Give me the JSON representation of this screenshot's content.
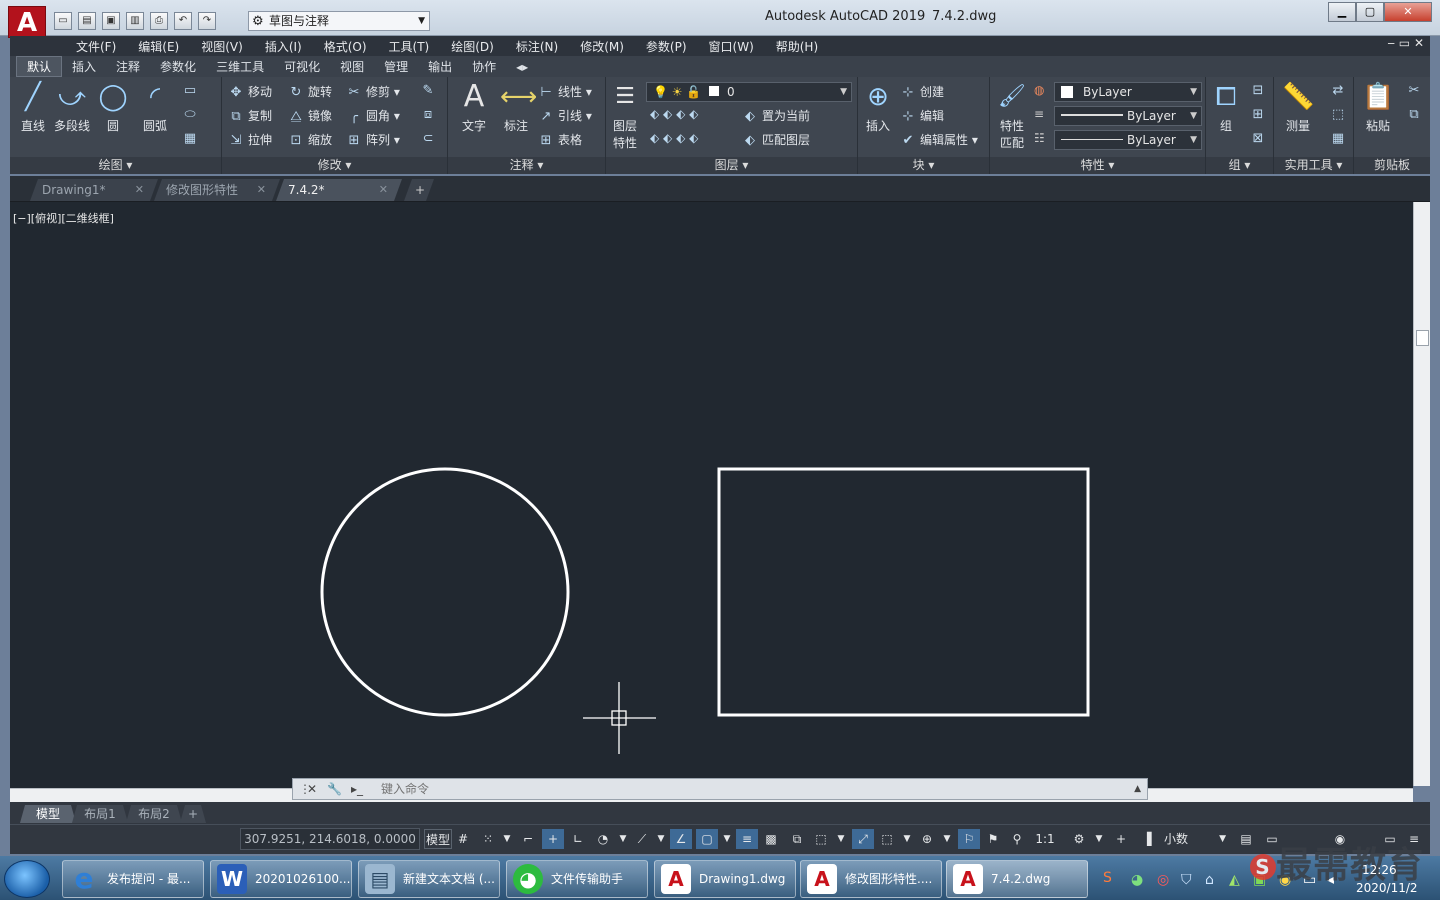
{
  "window": {
    "app_title": "Autodesk AutoCAD 2019",
    "file_title": "7.4.2.dwg",
    "workspace": "草图与注释",
    "logo_letter": "A"
  },
  "menu": [
    "文件(F)",
    "编辑(E)",
    "视图(V)",
    "插入(I)",
    "格式(O)",
    "工具(T)",
    "绘图(D)",
    "标注(N)",
    "修改(M)",
    "参数(P)",
    "窗口(W)",
    "帮助(H)"
  ],
  "ribbon_tabs": [
    "默认",
    "插入",
    "注释",
    "参数化",
    "三维工具",
    "可视化",
    "视图",
    "管理",
    "输出",
    "协作"
  ],
  "panels": {
    "draw": {
      "title": "绘图",
      "line": "直线",
      "polyline": "多段线",
      "circle": "圆",
      "arc": "圆弧"
    },
    "modify": {
      "title": "修改",
      "move": "移动",
      "rotate": "旋转",
      "trim": "修剪",
      "copy": "复制",
      "mirror": "镜像",
      "fillet": "圆角",
      "stretch": "拉伸",
      "scale": "缩放",
      "array": "阵列"
    },
    "annotation": {
      "title": "注释",
      "text": "文字",
      "dimension": "标注",
      "linear": "线性",
      "leader": "引线",
      "table": "表格"
    },
    "layers": {
      "title": "图层",
      "properties_1": "图层",
      "properties_2": "特性",
      "current_layer": "0",
      "set_current": "置为当前",
      "match_layer": "匹配图层"
    },
    "block": {
      "title": "块",
      "insert": "插入",
      "create": "创建",
      "edit": "编辑",
      "edit_attr": "编辑属性"
    },
    "properties": {
      "title": "特性",
      "match_1": "特性",
      "match_2": "匹配",
      "color": "ByLayer",
      "lineweight": "ByLayer",
      "linetype": "ByLayer"
    },
    "groups": {
      "title": "组",
      "group": "组"
    },
    "utilities": {
      "title": "实用工具",
      "measure": "测量"
    },
    "clipboard": {
      "title": "剪贴板",
      "paste": "粘贴"
    }
  },
  "doc_tabs": [
    {
      "label": "Drawing1*",
      "active": false
    },
    {
      "label": "修改图形特性",
      "active": false
    },
    {
      "label": "7.4.2*",
      "active": true
    }
  ],
  "viewport_label": "[−][俯视][二维线框]",
  "command_placeholder": "键入命令",
  "layout_tabs": [
    "模型",
    "布局1",
    "布局2"
  ],
  "status": {
    "coordinates": "307.9251, 214.6018, 0.0000",
    "model": "模型",
    "scale": "1:1",
    "units": "小数"
  },
  "taskbar": [
    {
      "label": "发布提问 - 最...",
      "icon": "ie-icon",
      "color": "#2f7fd6"
    },
    {
      "label": "20201026100...",
      "icon": "word-icon",
      "color": "#2b5fb8"
    },
    {
      "label": "新建文本文档 (...",
      "icon": "notepad-icon",
      "color": "#9bb7d0"
    },
    {
      "label": "文件传输助手",
      "icon": "wechat-icon",
      "color": "#2dbb3f"
    },
    {
      "label": "Drawing1.dwg",
      "icon": "autocad-icon",
      "color": "#c8121b"
    },
    {
      "label": "修改图形特性....",
      "icon": "autocad-icon",
      "color": "#c8121b"
    },
    {
      "label": "7.4.2.dwg",
      "icon": "autocad-icon",
      "color": "#c8121b"
    }
  ],
  "clock": {
    "time": "12:26",
    "date": "2020/11/2"
  },
  "watermark": "最需教育",
  "colors": {
    "canvas": "#212830",
    "ribbon": "#3f4650",
    "accent": "#c8121b"
  }
}
